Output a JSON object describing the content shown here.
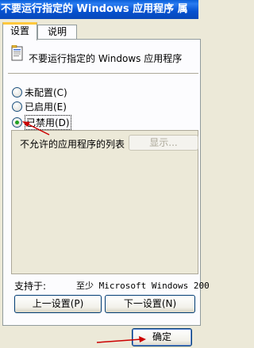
{
  "window": {
    "title": "不要运行指定的 Windows 应用程序 属"
  },
  "tabs": [
    {
      "label": "设置"
    },
    {
      "label": "说明"
    }
  ],
  "policy": {
    "title": "不要运行指定的 Windows 应用程序"
  },
  "radios": [
    {
      "label": "未配置(C)",
      "checked": false
    },
    {
      "label": "已启用(E)",
      "checked": false
    },
    {
      "label": "已禁用(D)",
      "checked": true
    }
  ],
  "options": {
    "list_label": "不允许的应用程序的列表",
    "show_button": "显示..."
  },
  "supported": {
    "label": "支持于:",
    "value": "至少 Microsoft Windows 200"
  },
  "buttons": {
    "prev": "上一设置(P)",
    "next": "下一设置(N)",
    "ok": "确定"
  },
  "annotation_color": "#cc0000"
}
